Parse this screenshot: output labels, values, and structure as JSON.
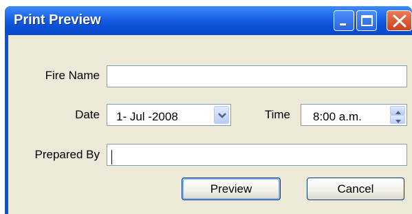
{
  "window": {
    "title": "Print Preview",
    "buttons": [
      "minimize-icon",
      "maximize-icon",
      "close-icon"
    ]
  },
  "form": {
    "fire_name_label": "Fire Name",
    "fire_name_value": "",
    "date_label": "Date",
    "date_value": "1- Jul -2008",
    "time_label": "Time",
    "time_value": "8:00 a.m.",
    "prepared_by_label": "Prepared By",
    "prepared_by_value": ""
  },
  "actions": {
    "preview_label": "Preview",
    "cancel_label": "Cancel"
  },
  "colors": {
    "titlebar": "#0a4fd6",
    "client_bg": "#ece9d8",
    "input_border": "#7f9db9"
  }
}
